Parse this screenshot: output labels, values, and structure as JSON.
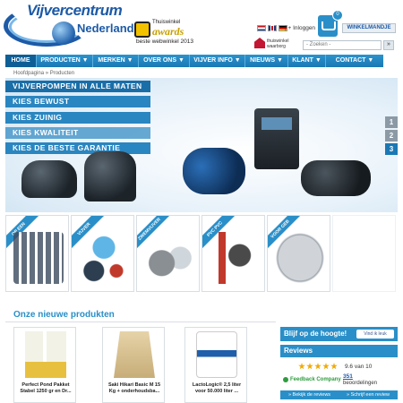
{
  "header": {
    "logo_line1": "Vijvercentrum",
    "logo_line2": "Nederland",
    "award": {
      "line1": "Thuiswinkel",
      "line2": "awards",
      "line3": "beste webwinkel 2013"
    },
    "login_label": "Inloggen",
    "cart_count": "0",
    "cart_label": "WINKELMANDJE",
    "trusted": {
      "line1": "thuiswinkel",
      "line2": "waarborg"
    },
    "search_placeholder": "- Zoeken -",
    "search_button": "»"
  },
  "nav": [
    {
      "label": "HOME",
      "active": true
    },
    {
      "label": "PRODUCTEN ▼"
    },
    {
      "label": "MERKEN ▼"
    },
    {
      "label": "OVER ONS ▼"
    },
    {
      "label": "VIJVER INFO ▼"
    },
    {
      "label": "NIEUWS ▼"
    },
    {
      "label": "KLANT ▼"
    },
    {
      "label": "CONTACT ▼"
    }
  ],
  "breadcrumb": "Hoofdpagina » Producten",
  "hero": {
    "bands": [
      "VIJVERPOMPEN IN ALLE MATEN",
      "KIES BEWUST",
      "KIES ZUINIG",
      "KIES KWALITEIT",
      "KIES DE BESTE GARANTIE"
    ],
    "slides": [
      "1",
      "2",
      "3"
    ],
    "active_slide": "3"
  },
  "categories": [
    {
      "ribbon": "OP EEN"
    },
    {
      "ribbon": "VIJVER"
    },
    {
      "ribbon": "ZWEMVIJVER"
    },
    {
      "ribbon": "PVC PVC"
    },
    {
      "ribbon": "VOOR GEB"
    },
    {
      "ribbon": ""
    }
  ],
  "new_products": {
    "title": "Onze nieuwe produkten",
    "items": [
      {
        "name": "Perfect Pond Pakket Stabel 1250 gr en Dr..."
      },
      {
        "name": "Saki Hikari Basic M 15 Kg + onderhoudsba..."
      },
      {
        "name": "LactoLogic® 2,5 liter voor 50.000 liter ..."
      }
    ]
  },
  "sidebar": {
    "facebook_title": "Blijf op de hoogte!",
    "facebook_like": "Vind ik leuk",
    "reviews_title": "Reviews",
    "rating": "9.6 van 10",
    "stars": 4.8,
    "feedback_company": "Feedback Company",
    "review_count": "351",
    "review_word": "beoordelingen",
    "links": [
      "» Bekijk de reviews",
      "» Schrijf een review"
    ]
  }
}
